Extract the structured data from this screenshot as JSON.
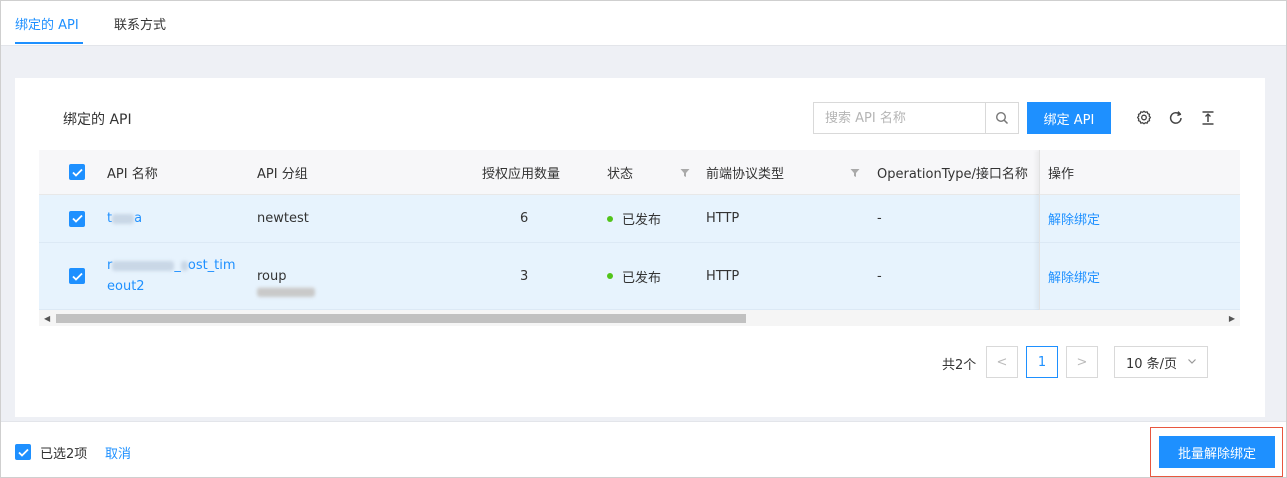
{
  "tabs": [
    {
      "label": "绑定的 API",
      "active": true
    },
    {
      "label": "联系方式",
      "active": false
    }
  ],
  "card": {
    "title": "绑定的 API",
    "search_placeholder": "搜索 API 名称",
    "bind_button": "绑定 API"
  },
  "table": {
    "headers": {
      "name": "API 名称",
      "group": "API 分组",
      "auth_count": "授权应用数量",
      "status": "状态",
      "protocol": "前端协议类型",
      "operation": "OperationType/接口名称",
      "action": "操作"
    },
    "rows": [
      {
        "name_prefix": "t",
        "name_suffix": "a",
        "group": "newtest",
        "auth_count": "6",
        "status": "已发布",
        "protocol": "HTTP",
        "operation": "-",
        "action": "解除绑定"
      },
      {
        "name_prefix": "r",
        "name_mid": "_",
        "name_suffix": "ost_tim",
        "name_line2": "eout2",
        "group_suffix": "roup",
        "auth_count": "3",
        "status": "已发布",
        "protocol": "HTTP",
        "operation": "-",
        "action": "解除绑定"
      }
    ]
  },
  "pagination": {
    "total": "共2个",
    "prev": "<",
    "current": "1",
    "next": ">",
    "page_size": "10 条/页"
  },
  "footer": {
    "selected": "已选2项",
    "cancel": "取消",
    "batch_unbind": "批量解除绑定"
  },
  "colors": {
    "accent": "#1e90ff",
    "status_published": "#52c41a",
    "highlight": "#e8573f"
  }
}
